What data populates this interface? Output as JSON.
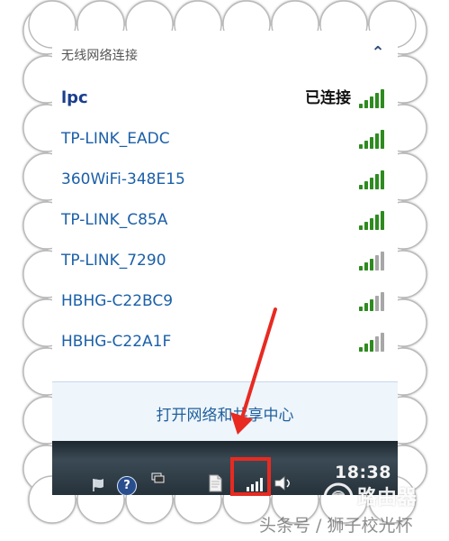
{
  "header": {
    "section_title": "无线网络连接",
    "collapse_glyph": "⌃"
  },
  "networks": [
    {
      "name": "lpc",
      "status": "已连接",
      "signal_bars": 5,
      "connected": true
    },
    {
      "name": "TP-LINK_EADC",
      "signal_bars": 5
    },
    {
      "name": "360WiFi-348E15",
      "signal_bars": 5
    },
    {
      "name": "TP-LINK_C85A",
      "signal_bars": 5
    },
    {
      "name": "TP-LINK_7290",
      "signal_bars": 3
    },
    {
      "name": "HBHG-C22BC9",
      "signal_bars": 3
    },
    {
      "name": "HBHG-C22A1F",
      "signal_bars": 3
    }
  ],
  "footer": {
    "link_text": "打开网络和共享中心"
  },
  "taskbar": {
    "time": "18:38",
    "help_icon_label": "?"
  },
  "watermarks": {
    "logo_text": "路由器",
    "bottom_text": "头条号 / 狮子校光杯"
  },
  "icons": {
    "collapse": "chevron-up-icon",
    "signal": "wifi-signal-icon",
    "help": "help-icon",
    "flag": "action-center-icon",
    "window": "show-window-icon",
    "document": "document-icon",
    "tray_network": "network-tray-icon",
    "volume": "volume-icon",
    "annotation": "red-arrow"
  },
  "colors": {
    "network_link": "#1b5fa8",
    "connected_name": "#1b3f8d",
    "signal_active": "#2e8b1f",
    "signal_inactive": "#a7a7a7",
    "highlight_red": "#e82a21",
    "footer_bg": "#eef5fb"
  }
}
